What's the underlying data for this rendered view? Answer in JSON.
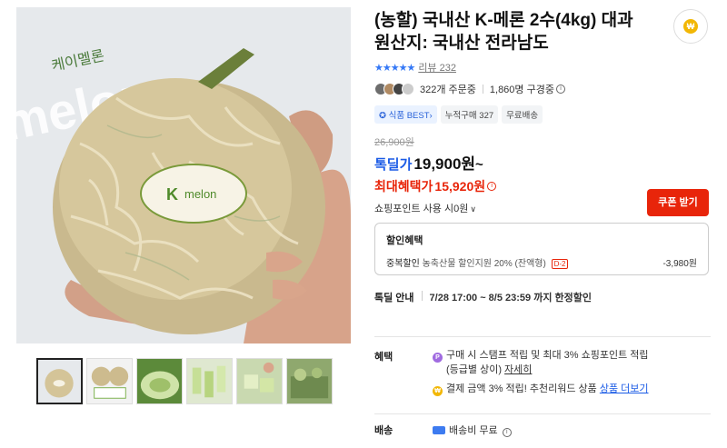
{
  "product": {
    "title": "(농할) 국내산 K-메론 2수(4kg) 대과",
    "origin": "원산지: 국내산 전라남도",
    "stars": "★★★★★",
    "review_label": "리뷰 232"
  },
  "gallery": {
    "main_image_alt": "케이멜론 melon",
    "thumbnail_count": 6,
    "active_thumbnail": 1
  },
  "buyers": {
    "orders": "322개 주문중",
    "subscribers": "1,860명 구경중"
  },
  "tags": [
    "✪ 식품 BEST›",
    "누적구매 327",
    "무료배송"
  ],
  "pricing": {
    "original": "26,900원",
    "deal_label": "톡딜가",
    "deal_price": "19,900원",
    "deal_suffix": "~",
    "max_label": "최대혜택가",
    "max_price": "15,920원",
    "coupon_button": "쿠폰 받기",
    "point_usage": "쇼핑포인트 사용 시0원",
    "point_chevron": "∨"
  },
  "discount": {
    "title": "할인혜택",
    "row_label": "중복할인",
    "row_desc": "농축산물 할인지원 20% (잔액형)",
    "row_badge": "D-2",
    "row_value": "-3,980원"
  },
  "deal_info": {
    "label": "톡딜 안내",
    "text": "7/28 17:00 ~ 8/5 23:59 까지 한정할인"
  },
  "benefits": {
    "label": "혜택",
    "line1": "구매 시 스탬프 적립 및 최대 3% 쇼핑포인트 적립",
    "line1b": "(등급별 상이)",
    "line1_link": "자세히",
    "line2": "결제 금액 3% 적립! 추천리워드 상품",
    "line2_link": "상품 더보기",
    "p_coin": "P",
    "w_coin": "₩"
  },
  "shipping": {
    "label": "배송",
    "value": "배송비 무료"
  },
  "wallet_icon": "₩",
  "colors": {
    "deal_blue": "#1a5be6",
    "max_red": "#e8250a",
    "coupon_bg": "#e8250a",
    "star_blue": "#3478f6"
  }
}
